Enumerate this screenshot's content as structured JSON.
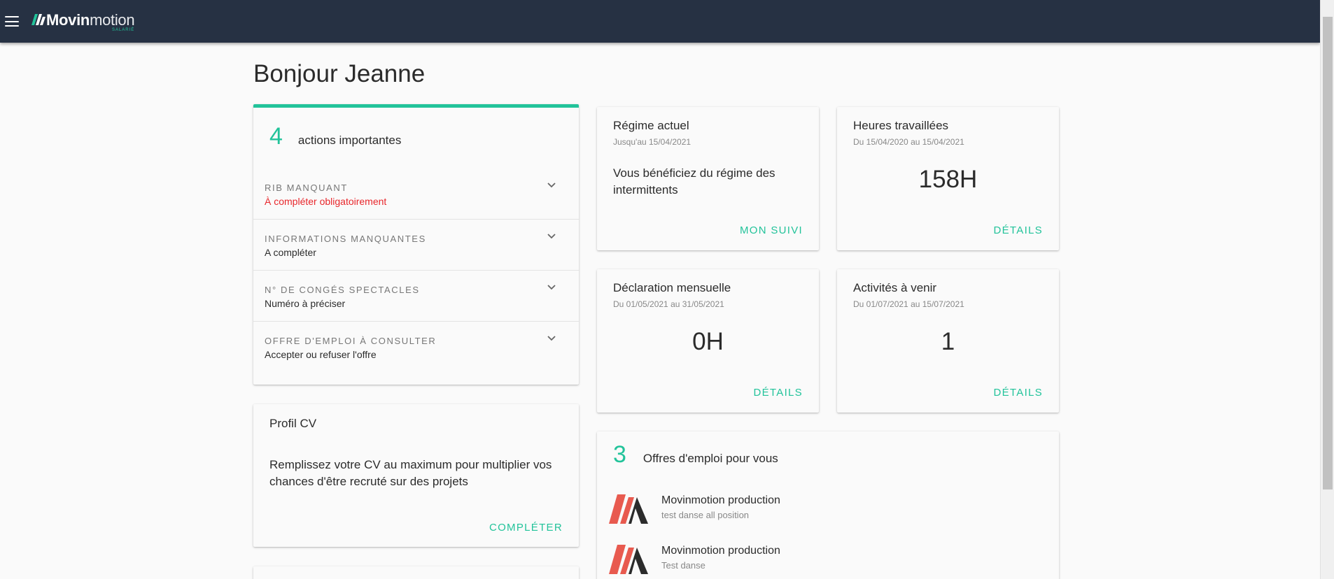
{
  "app": {
    "logo_bold": "Movin",
    "logo_light": "motion",
    "logo_sub": "SALARIÉ",
    "brand_color": "#22c39a",
    "nav_color": "#263143"
  },
  "greeting": "Bonjour Jeanne",
  "actions": {
    "count": "4",
    "title": "actions importantes",
    "items": [
      {
        "label": "RIB MANQUANT",
        "value": "À compléter obligatoirement",
        "alert": true
      },
      {
        "label": "INFORMATIONS MANQUANTES",
        "value": "A compléter",
        "alert": false
      },
      {
        "label": "N° DE CONGÉS SPECTACLES",
        "value": "Numéro à préciser",
        "alert": false
      },
      {
        "label": "OFFRE D'EMPLOI À CONSULTER",
        "value": "Accepter ou refuser l'offre",
        "alert": false
      }
    ]
  },
  "profil": {
    "title": "Profil CV",
    "text": "Remplissez votre CV au maximum pour multiplier vos chances d'être recruté sur des projets",
    "link": "COMPLÉTER"
  },
  "regime": {
    "title": "Régime actuel",
    "subtitle": "Jusqu'au 15/04/2021",
    "text": "Vous bénéficiez du régime des intermittents",
    "link": "MON SUIVI"
  },
  "heures": {
    "title": "Heures travaillées",
    "subtitle": "Du 15/04/2020 au 15/04/2021",
    "value": "158H",
    "link": "DÉTAILS"
  },
  "declaration": {
    "title": "Déclaration mensuelle",
    "subtitle": "Du 01/05/2021 au 31/05/2021",
    "value": "0H",
    "link": "DÉTAILS"
  },
  "activites": {
    "title": "Activités à venir",
    "subtitle": "Du 01/07/2021 au 15/07/2021",
    "value": "1",
    "link": "DÉTAILS"
  },
  "offres": {
    "count": "3",
    "title": "Offres d'emploi pour vous",
    "items": [
      {
        "company": "Movinmotion production",
        "job": "test danse all position"
      },
      {
        "company": "Movinmotion production",
        "job": "Test danse"
      }
    ]
  }
}
